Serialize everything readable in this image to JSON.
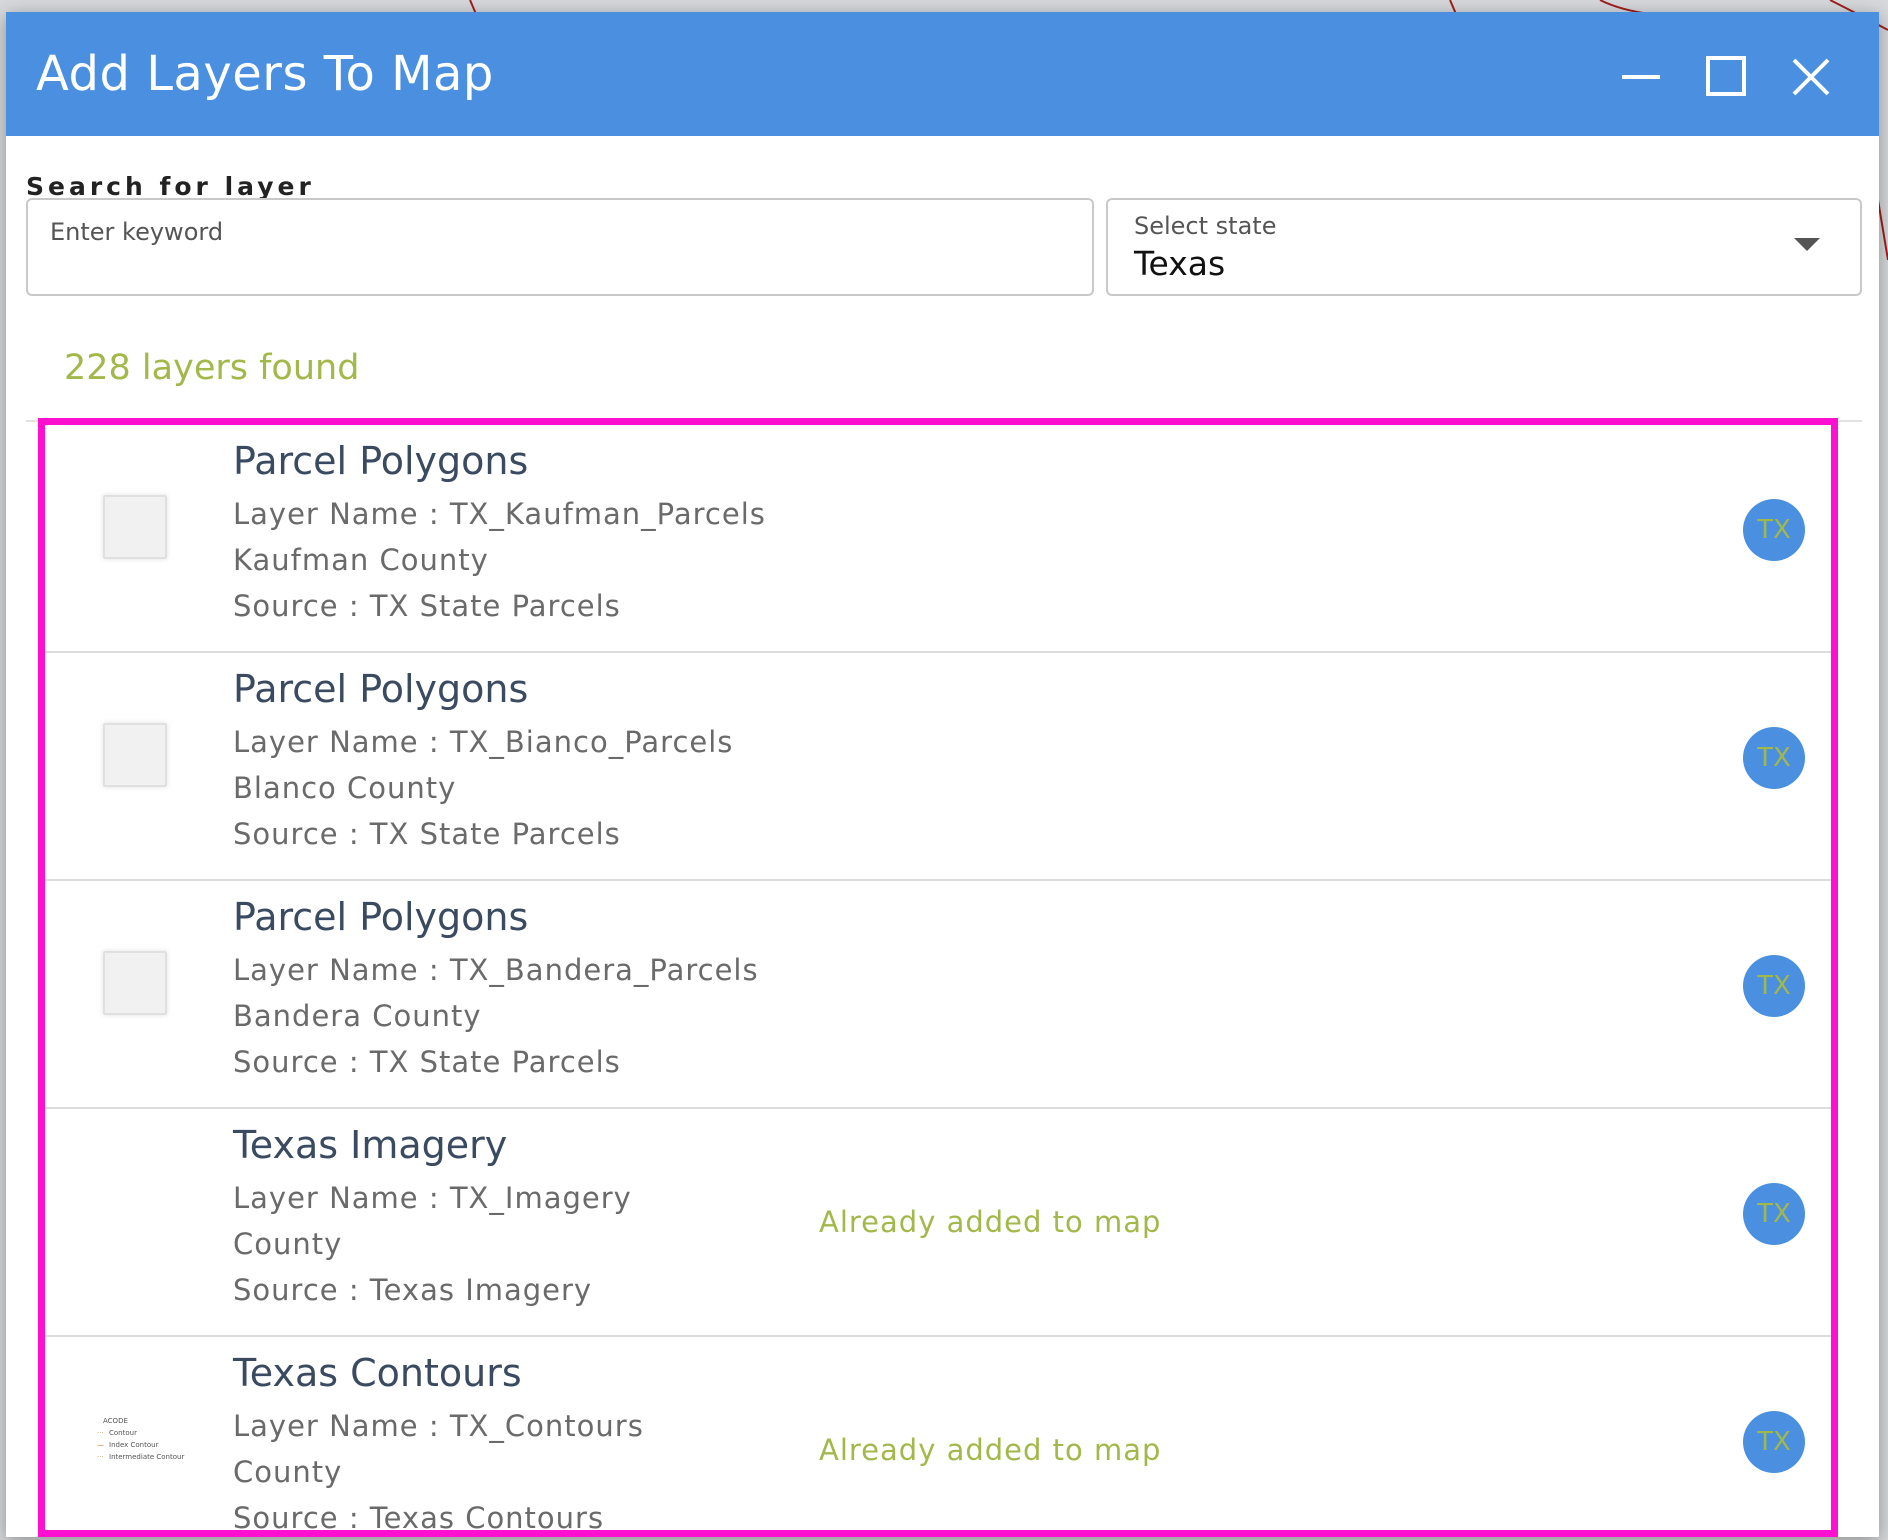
{
  "dialog": {
    "title": "Add Layers To Map"
  },
  "search": {
    "label": "Search for layer",
    "keyword_placeholder": "Enter keyword",
    "keyword_value": "",
    "state_label": "Select state",
    "state_value": "Texas"
  },
  "results": {
    "count_text": "228 layers found"
  },
  "layers": [
    {
      "title": "Parcel Polygons",
      "layer_name": "Layer Name : TX_Kaufman_Parcels",
      "county": "Kaufman County",
      "source": "Source : TX State Parcels",
      "status": "",
      "badge": "TX"
    },
    {
      "title": "Parcel Polygons",
      "layer_name": "Layer Name : TX_Bianco_Parcels",
      "county": "Blanco County",
      "source": "Source : TX State Parcels",
      "status": "",
      "badge": "TX"
    },
    {
      "title": "Parcel Polygons",
      "layer_name": "Layer Name : TX_Bandera_Parcels",
      "county": "Bandera County",
      "source": "Source : TX State Parcels",
      "status": "",
      "badge": "TX"
    },
    {
      "title": "Texas Imagery",
      "layer_name": "Layer Name : TX_Imagery",
      "county": "County",
      "source": "Source : Texas Imagery",
      "status": "Already added to map",
      "badge": "TX"
    },
    {
      "title": "Texas Contours",
      "layer_name": "Layer Name : TX_Contours",
      "county": "County",
      "source": "Source : Texas Contours",
      "status": "Already added to map",
      "badge": "TX",
      "legend": {
        "heading": "ACODE",
        "items": [
          "Contour",
          "Index Contour",
          "Intermediate Contour"
        ]
      }
    }
  ],
  "colors": {
    "titlebar": "#4a8fe0",
    "accent_green": "#a3b84a",
    "highlight": "#ff10d0"
  }
}
